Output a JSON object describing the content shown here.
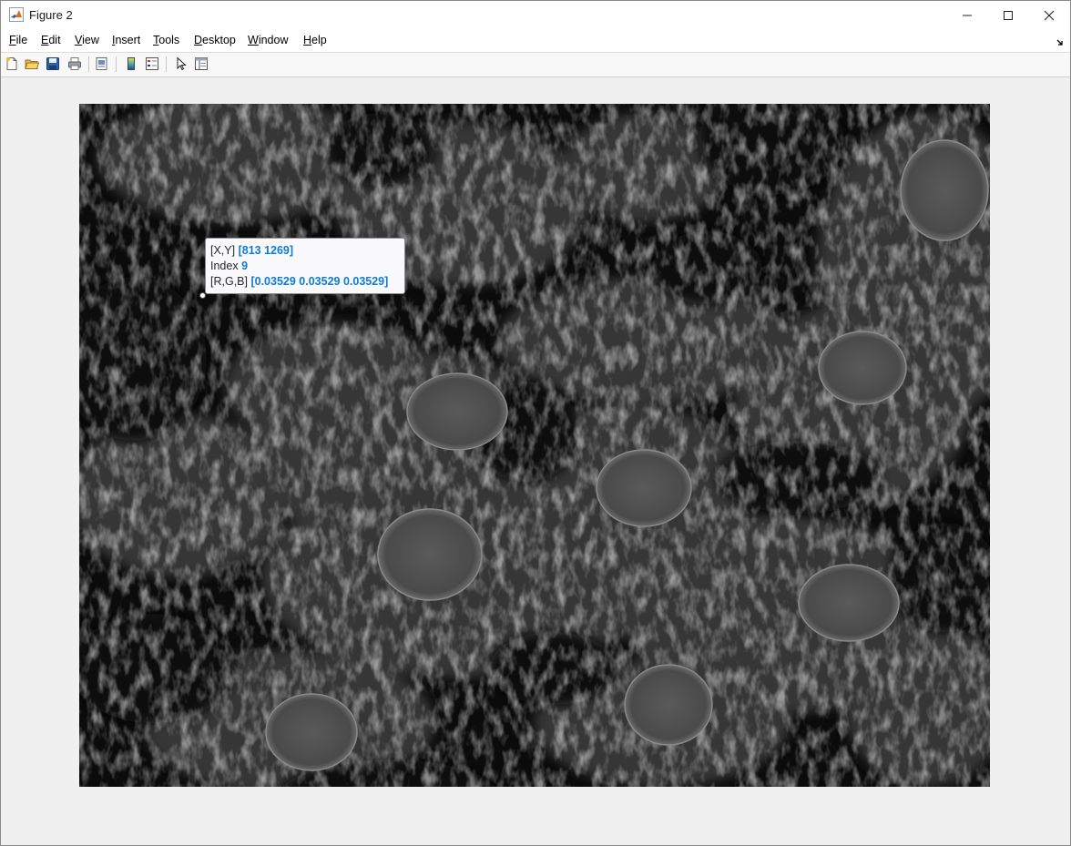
{
  "window": {
    "title": "Figure 2"
  },
  "menu": [
    {
      "label": "File",
      "mnemonic": "F",
      "rest": "ile"
    },
    {
      "label": "Edit",
      "mnemonic": "E",
      "rest": "dit"
    },
    {
      "label": "View",
      "mnemonic": "V",
      "rest": "iew"
    },
    {
      "label": "Insert",
      "mnemonic": "I",
      "rest": "nsert"
    },
    {
      "label": "Tools",
      "mnemonic": "T",
      "rest": "ools"
    },
    {
      "label": "Desktop",
      "mnemonic": "D",
      "rest": "esktop"
    },
    {
      "label": "Window",
      "mnemonic": "W",
      "rest": "indow"
    },
    {
      "label": "Help",
      "mnemonic": "H",
      "rest": "elp"
    }
  ],
  "toolbar": {
    "buttons": [
      "new-figure-icon",
      "open-file-icon",
      "save-icon",
      "print-icon",
      "print-preview-icon",
      "insert-colorbar-icon",
      "insert-legend-icon",
      "edit-plot-icon",
      "property-inspector-icon"
    ]
  },
  "datatip": {
    "xy_label": "[X,Y]",
    "xy_value": "[813 1269]",
    "index_label": "Index",
    "index_value": "9",
    "rgb_label": "[R,G,B]",
    "rgb_value": "[0.03529 0.03529 0.03529]"
  },
  "colors": {
    "datatip_value": "#0e7bd8",
    "image_background": "#0c0c0c"
  }
}
